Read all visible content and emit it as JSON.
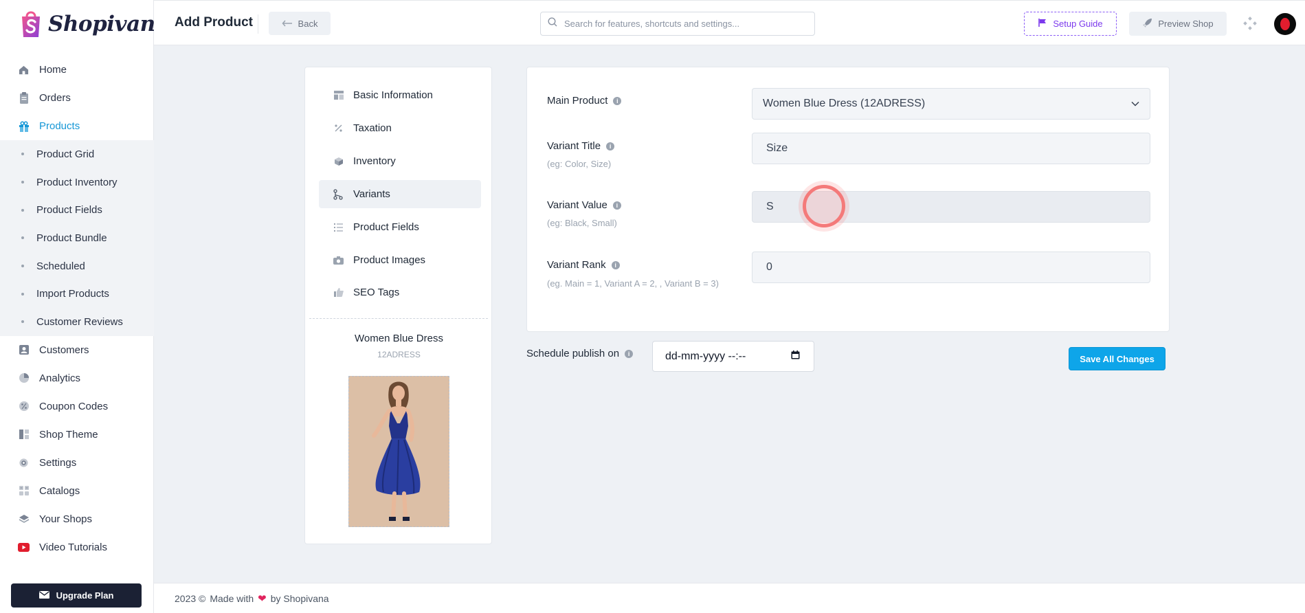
{
  "brand": {
    "name": "Shopivana"
  },
  "sidebar": {
    "items": [
      {
        "label": "Home",
        "icon": "home-icon"
      },
      {
        "label": "Orders",
        "icon": "clipboard-icon"
      },
      {
        "label": "Products",
        "icon": "gift-icon",
        "active": true
      }
    ],
    "product_sub": [
      {
        "label": "Product Grid"
      },
      {
        "label": "Product Inventory"
      },
      {
        "label": "Product Fields"
      },
      {
        "label": "Product Bundle"
      },
      {
        "label": "Scheduled"
      },
      {
        "label": "Import Products"
      },
      {
        "label": "Customer Reviews"
      }
    ],
    "items_after": [
      {
        "label": "Customers",
        "icon": "user-card-icon"
      },
      {
        "label": "Analytics",
        "icon": "pie-chart-icon"
      },
      {
        "label": "Coupon Codes",
        "icon": "percent-badge-icon"
      },
      {
        "label": "Shop Theme",
        "icon": "layout-icon"
      },
      {
        "label": "Settings",
        "icon": "gear-icon"
      },
      {
        "label": "Catalogs",
        "icon": "grid-icon"
      },
      {
        "label": "Your Shops",
        "icon": "layers-icon"
      },
      {
        "label": "Video Tutorials",
        "icon": "youtube-icon"
      }
    ],
    "upgrade_label": "Upgrade Plan"
  },
  "header": {
    "title": "Add Product",
    "back_label": "Back",
    "search_placeholder": "Search for features, shortcuts and settings...",
    "setup_label": "Setup Guide",
    "preview_label": "Preview Shop"
  },
  "tabs": [
    {
      "label": "Basic Information",
      "icon": "table-icon"
    },
    {
      "label": "Taxation",
      "icon": "percent-icon"
    },
    {
      "label": "Inventory",
      "icon": "box-icon"
    },
    {
      "label": "Variants",
      "icon": "branch-icon",
      "active": true
    },
    {
      "label": "Product Fields",
      "icon": "list-icon"
    },
    {
      "label": "Product Images",
      "icon": "camera-icon"
    },
    {
      "label": "SEO Tags",
      "icon": "thumbs-up-icon"
    }
  ],
  "product": {
    "name": "Women Blue Dress",
    "sku": "12ADRESS"
  },
  "form": {
    "main_product": {
      "label": "Main Product",
      "value": "Women Blue Dress (12ADRESS)"
    },
    "variant_title": {
      "label": "Variant Title",
      "hint": "(eg: Color, Size)",
      "value": "Size"
    },
    "variant_value": {
      "label": "Variant Value",
      "hint": "(eg: Black, Small)",
      "value": "S"
    },
    "variant_rank": {
      "label": "Variant Rank",
      "hint": "(eg. Main = 1, Variant A = 2, , Variant B = 3)",
      "value": "0"
    }
  },
  "schedule": {
    "label": "Schedule publish on",
    "placeholder": "dd-mm-yyyy --:--"
  },
  "save_label": "Save All Changes",
  "footer": {
    "year": "2023 ©",
    "made_with": "Made with",
    "by": "by Shopivana"
  },
  "colors": {
    "accent": "#1597d6",
    "save": "#0ea5e9",
    "setup": "#7c3aed",
    "upgrade_bg": "#1b2134"
  }
}
